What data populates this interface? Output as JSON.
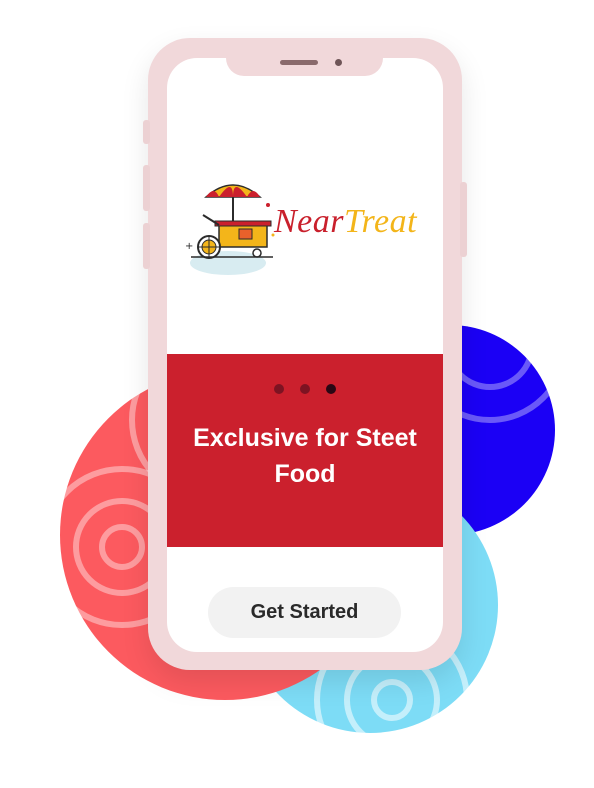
{
  "brand": {
    "part1": "Near",
    "part2": "Treat"
  },
  "banner": {
    "title": "Exclusive for Steet Food",
    "active_dot": 2,
    "dot_count": 3
  },
  "actions": {
    "get_started_label": "Get Started"
  },
  "colors": {
    "brand_red": "#cb202d",
    "brand_yellow": "#f3b51a",
    "blob_red": "#fc5a5f",
    "blob_blue": "#1b00f5",
    "blob_cyan": "#7ddcf6",
    "phone_frame": "#f1d8da"
  },
  "icons": [
    "food-cart-icon"
  ]
}
